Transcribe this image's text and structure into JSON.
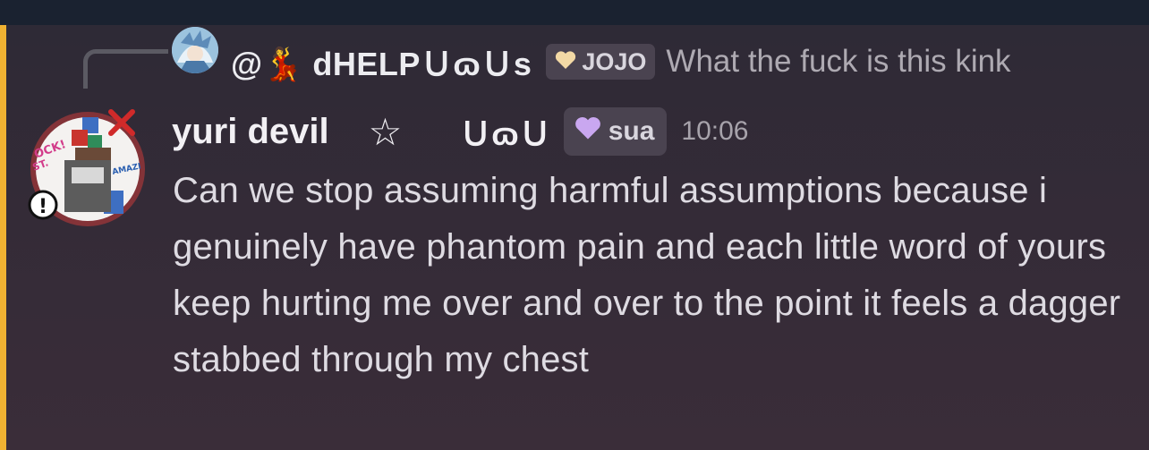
{
  "reply": {
    "name": "@💃 dHELPＵɷＵs",
    "tag_label": "JOJO",
    "text": "What the fuck is this kink"
  },
  "message": {
    "author": "yuri devil",
    "star": "☆",
    "face": "ＵɷＵ",
    "role_label": "sua",
    "timestamp": "10:06",
    "body": "Can we stop assuming harmful assumptions because i genuinely have phantom pain and each little word of yours keep hurting me over and over to the point it feels a dagger stabbed through my chest"
  },
  "colors": {
    "mention_bar": "#f0b232",
    "tag_heart": "#f3d9a5",
    "role_heart": "#c9a7f0"
  },
  "icons": {
    "reply_avatar": "anime-character-avatar",
    "main_avatar": "pixel-art-avatar",
    "angry_emoji": "anger-symbol-icon"
  }
}
